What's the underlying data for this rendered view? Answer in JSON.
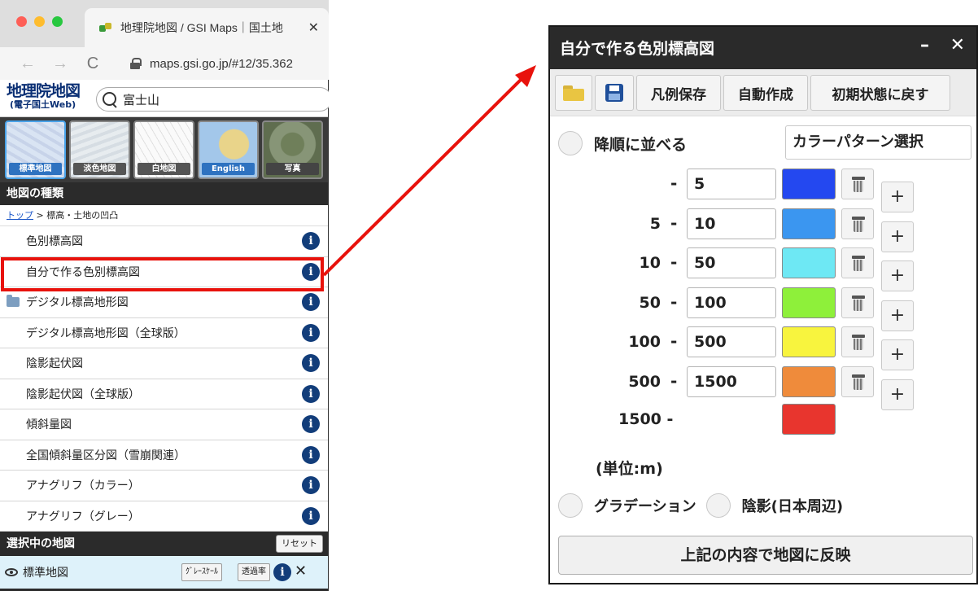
{
  "browser": {
    "tab_title": "地理院地図 / GSI Maps｜国土地",
    "tab_close": "✕",
    "back": "←",
    "forward": "→",
    "reload": "C",
    "url": "maps.gsi.go.jp/#12/35.362"
  },
  "gsi": {
    "logo_main": "地理院地図",
    "logo_sub": "(電子国土Web)",
    "search_value": "富士山",
    "basemaps": [
      "標準地図",
      "淡色地図",
      "白地図",
      "English",
      "写真"
    ],
    "map_types_title": "地図の種類",
    "breadcrumb_link": "トップ",
    "breadcrumb_rest": " > 標高・土地の凹凸",
    "items": [
      {
        "label": "色別標高図",
        "folder": false
      },
      {
        "label": "自分で作る色別標高図",
        "folder": false
      },
      {
        "label": "デジタル標高地形図",
        "folder": true
      },
      {
        "label": "デジタル標高地形図（全球版）",
        "folder": false
      },
      {
        "label": "陰影起伏図",
        "folder": false
      },
      {
        "label": "陰影起伏図（全球版）",
        "folder": false
      },
      {
        "label": "傾斜量図",
        "folder": false
      },
      {
        "label": "全国傾斜量区分図（雪崩関連）",
        "folder": false
      },
      {
        "label": "アナグリフ（カラー）",
        "folder": false
      },
      {
        "label": "アナグリフ（グレー）",
        "folder": false
      }
    ],
    "info_glyph": "i",
    "selected_title": "選択中の地図",
    "reset_label": "リセット",
    "selected_map": "標準地図",
    "grayscale_label": "ｸﾞﾚｰｽｹｰﾙ",
    "opacity_label": "透過率",
    "remove_glyph": "✕"
  },
  "panel": {
    "title": "自分で作る色別標高図",
    "minimize": "–",
    "close": "✕",
    "toolbar": {
      "save_legend": "凡例保存",
      "auto_create": "自動作成",
      "reset_initial": "初期状態に戻す"
    },
    "sort_label": "降順に並べる",
    "pattern_select": "カラーパターン選択",
    "dash": "-",
    "ranges": [
      {
        "from": "",
        "to": "5",
        "color": "#2448f0"
      },
      {
        "from": "5",
        "to": "10",
        "color": "#3b96f0"
      },
      {
        "from": "10",
        "to": "50",
        "color": "#6ee8f4"
      },
      {
        "from": "50",
        "to": "100",
        "color": "#8ef03a"
      },
      {
        "from": "100",
        "to": "500",
        "color": "#f8f43e"
      },
      {
        "from": "500",
        "to": "1500",
        "color": "#ef8b3b"
      }
    ],
    "last_from": "1500 -",
    "last_color": "#e8352e",
    "add_glyph": "+",
    "unit": "(単位:m)",
    "gradation_label": "グラデーション",
    "hillshade_label": "陰影(日本周辺)",
    "apply_label": "上記の内容で地図に反映"
  },
  "colors": {
    "highlight": "#e8120c",
    "arrow": "#e8120c"
  }
}
